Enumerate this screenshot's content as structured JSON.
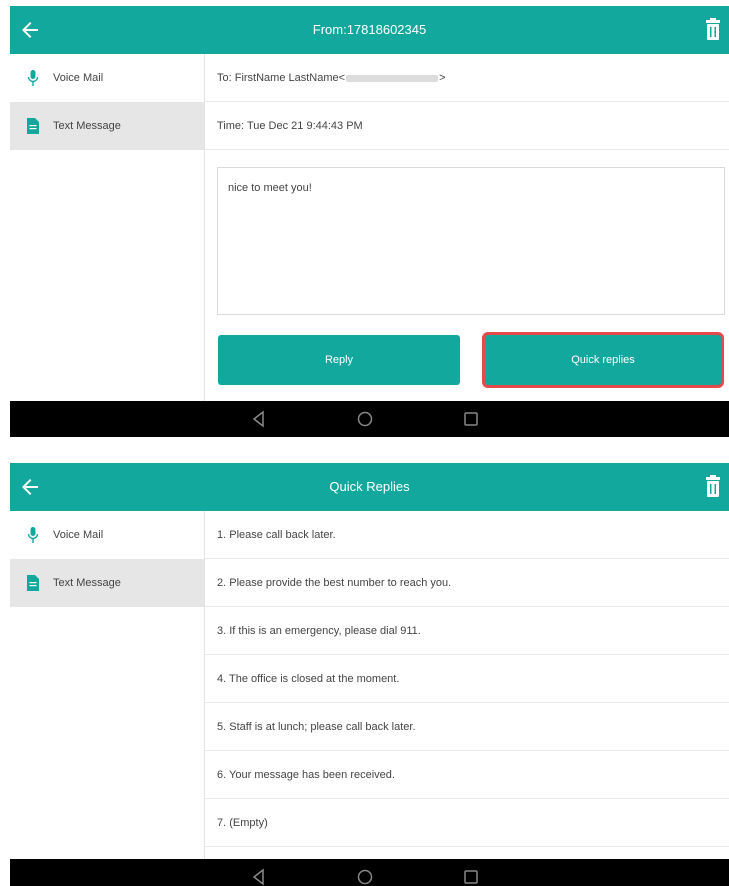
{
  "colors": {
    "accent": "#13a89e",
    "highlight": "#e54b4b",
    "navbar": "#000000",
    "active_item": "#e6e6e6"
  },
  "icons": {
    "back": "arrow-left-icon",
    "delete": "trash-icon",
    "voice_mail": "microphone-icon",
    "text_message": "document-icon",
    "nav_back": "triangle-back-icon",
    "nav_home": "circle-home-icon",
    "nav_recent": "square-recent-icon"
  },
  "screen1": {
    "title": "From:17818602345",
    "sidebar": {
      "items": [
        {
          "label": "Voice Mail"
        },
        {
          "label": "Text Message"
        }
      ]
    },
    "to_prefix": "To: FirstName LastName<",
    "to_suffix": ">",
    "time": "Time: Tue Dec 21 9:44:43 PM",
    "message": "nice to meet you!",
    "reply_label": "Reply",
    "quick_label": "Quick replies"
  },
  "screen2": {
    "title": "Quick Replies",
    "sidebar": {
      "items": [
        {
          "label": "Voice Mail"
        },
        {
          "label": "Text Message"
        }
      ]
    },
    "replies": [
      "1. Please call back later.",
      "2. Please provide the best number to reach you.",
      "3. If this is an emergency, please dial 911.",
      "4. The office is closed at the moment.",
      "5. Staff is at lunch; please call back later.",
      "6. Your message has been received.",
      "7. (Empty)"
    ]
  }
}
